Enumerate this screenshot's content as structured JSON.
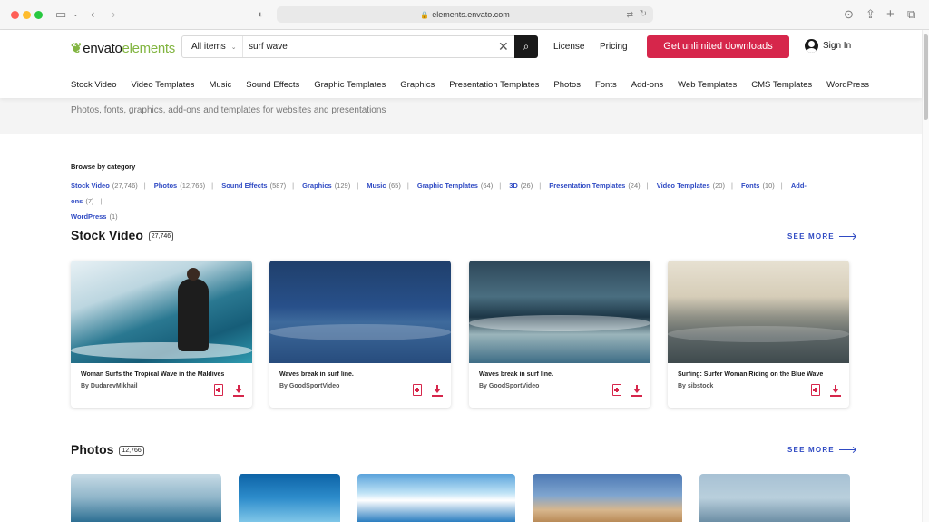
{
  "browser": {
    "url": "elements.envato.com"
  },
  "header": {
    "logo_prefix": "envato",
    "logo_suffix": "elements",
    "search_scope": "All items",
    "search_query": "surf wave",
    "license": "License",
    "pricing": "Pricing",
    "cta": "Get unlimited downloads",
    "signin": "Sign In"
  },
  "nav": [
    "Stock Video",
    "Video Templates",
    "Music",
    "Sound Effects",
    "Graphic Templates",
    "Graphics",
    "Presentation Templates",
    "Photos",
    "Fonts",
    "Add-ons",
    "Web Templates",
    "CMS Templates",
    "WordPress"
  ],
  "hero": {
    "subtitle": "Photos, fonts, graphics, add-ons and templates for websites and presentations"
  },
  "browse": {
    "title": "Browse by category",
    "categories": [
      {
        "name": "Stock Video",
        "count": "(27,746)"
      },
      {
        "name": "Photos",
        "count": "(12,766)"
      },
      {
        "name": "Sound Effects",
        "count": "(587)"
      },
      {
        "name": "Graphics",
        "count": "(129)"
      },
      {
        "name": "Music",
        "count": "(65)"
      },
      {
        "name": "Graphic Templates",
        "count": "(64)"
      },
      {
        "name": "3D",
        "count": "(26)"
      },
      {
        "name": "Presentation Templates",
        "count": "(24)"
      },
      {
        "name": "Video Templates",
        "count": "(20)"
      },
      {
        "name": "Fonts",
        "count": "(10)"
      },
      {
        "name": "Add-ons",
        "count": "(7)"
      },
      {
        "name": "WordPress",
        "count": "(1)"
      }
    ]
  },
  "stock_video": {
    "title": "Stock Video",
    "count": "27,746",
    "see_more": "SEE MORE",
    "items": [
      {
        "title": "Woman Surfs the Tropical Wave in the Maldives",
        "author": "By DudarevMikhail"
      },
      {
        "title": "Waves break in surf line.",
        "author": "By GoodSportVideo"
      },
      {
        "title": "Waves break in surf line.",
        "author": "By GoodSportVideo"
      },
      {
        "title": "Surfing: Surfer Woman Riding on the Blue Wave",
        "author": "By sibstock"
      }
    ]
  },
  "photos": {
    "title": "Photos",
    "count": "12,766",
    "see_more": "SEE MORE"
  },
  "colors": {
    "accent": "#d6264b",
    "link": "#2f4ac3",
    "brand_green": "#82b541"
  }
}
